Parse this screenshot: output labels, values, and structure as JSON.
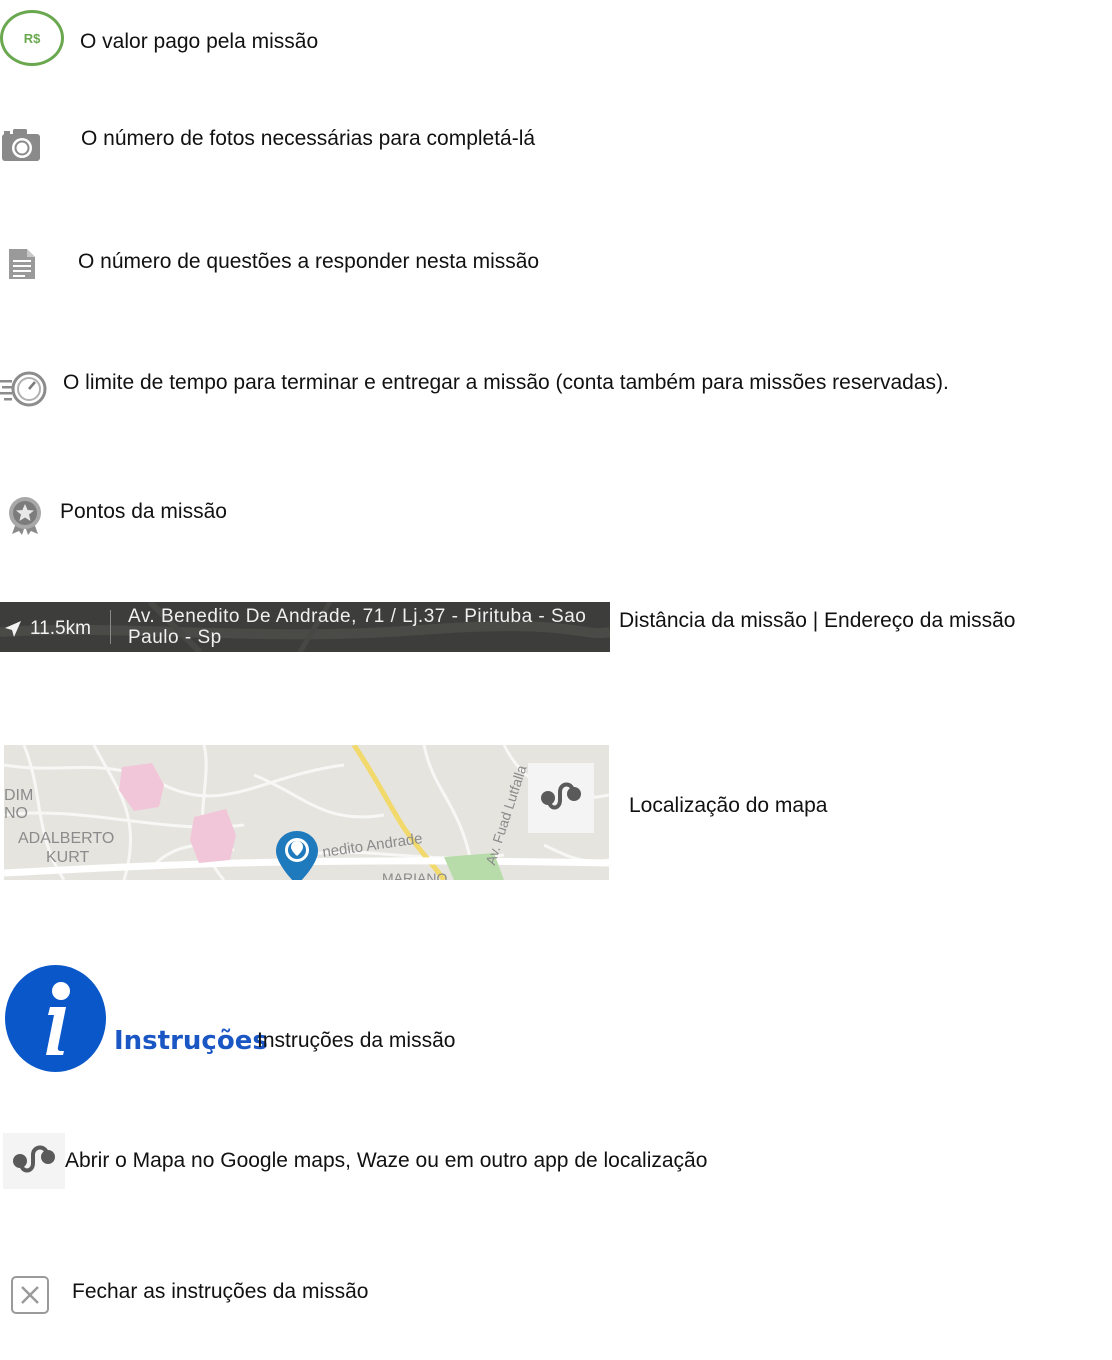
{
  "items": {
    "reward": {
      "badge": "R$",
      "text": "O  valor pago pela missão",
      "icon": "money-badge-icon",
      "color": "#6aa84f"
    },
    "photos": {
      "text": "O número de fotos necessárias para completá-lá",
      "icon": "camera-icon"
    },
    "questions": {
      "text": "O número de questões a responder nesta missão",
      "icon": "document-icon"
    },
    "time": {
      "text": "O limite de tempo para terminar e entregar a missão (conta também para missões reservadas).",
      "icon": "timer-icon"
    },
    "points": {
      "text": "Pontos da missão",
      "icon": "medal-icon"
    },
    "distance": {
      "distance_value": "11.5km",
      "address": "Av. Benedito De Andrade, 71 / Lj.37 - Pirituba - Sao Paulo - Sp",
      "text": "Distância da missão |  Endereço da missão",
      "icon": "navigation-arrow-icon"
    },
    "map": {
      "text": "Localização do mapa",
      "labels": [
        "DIM",
        "NO",
        "ADALBERTO",
        "KURT",
        "nedito Andrade",
        "Av. Fuad Lutfalla",
        "MARIANO"
      ],
      "icon": "map-pin-icon"
    },
    "instructions": {
      "label": "Instruções",
      "text": "Instruções da missão",
      "icon": "info-icon",
      "color": "#0a57c9"
    },
    "open_map": {
      "text": "Abrir o Mapa no Google maps, Waze ou em outro app de localização",
      "icon": "route-ab-icon"
    },
    "close": {
      "text": "Fechar as instruções da missão",
      "icon": "close-icon"
    }
  }
}
